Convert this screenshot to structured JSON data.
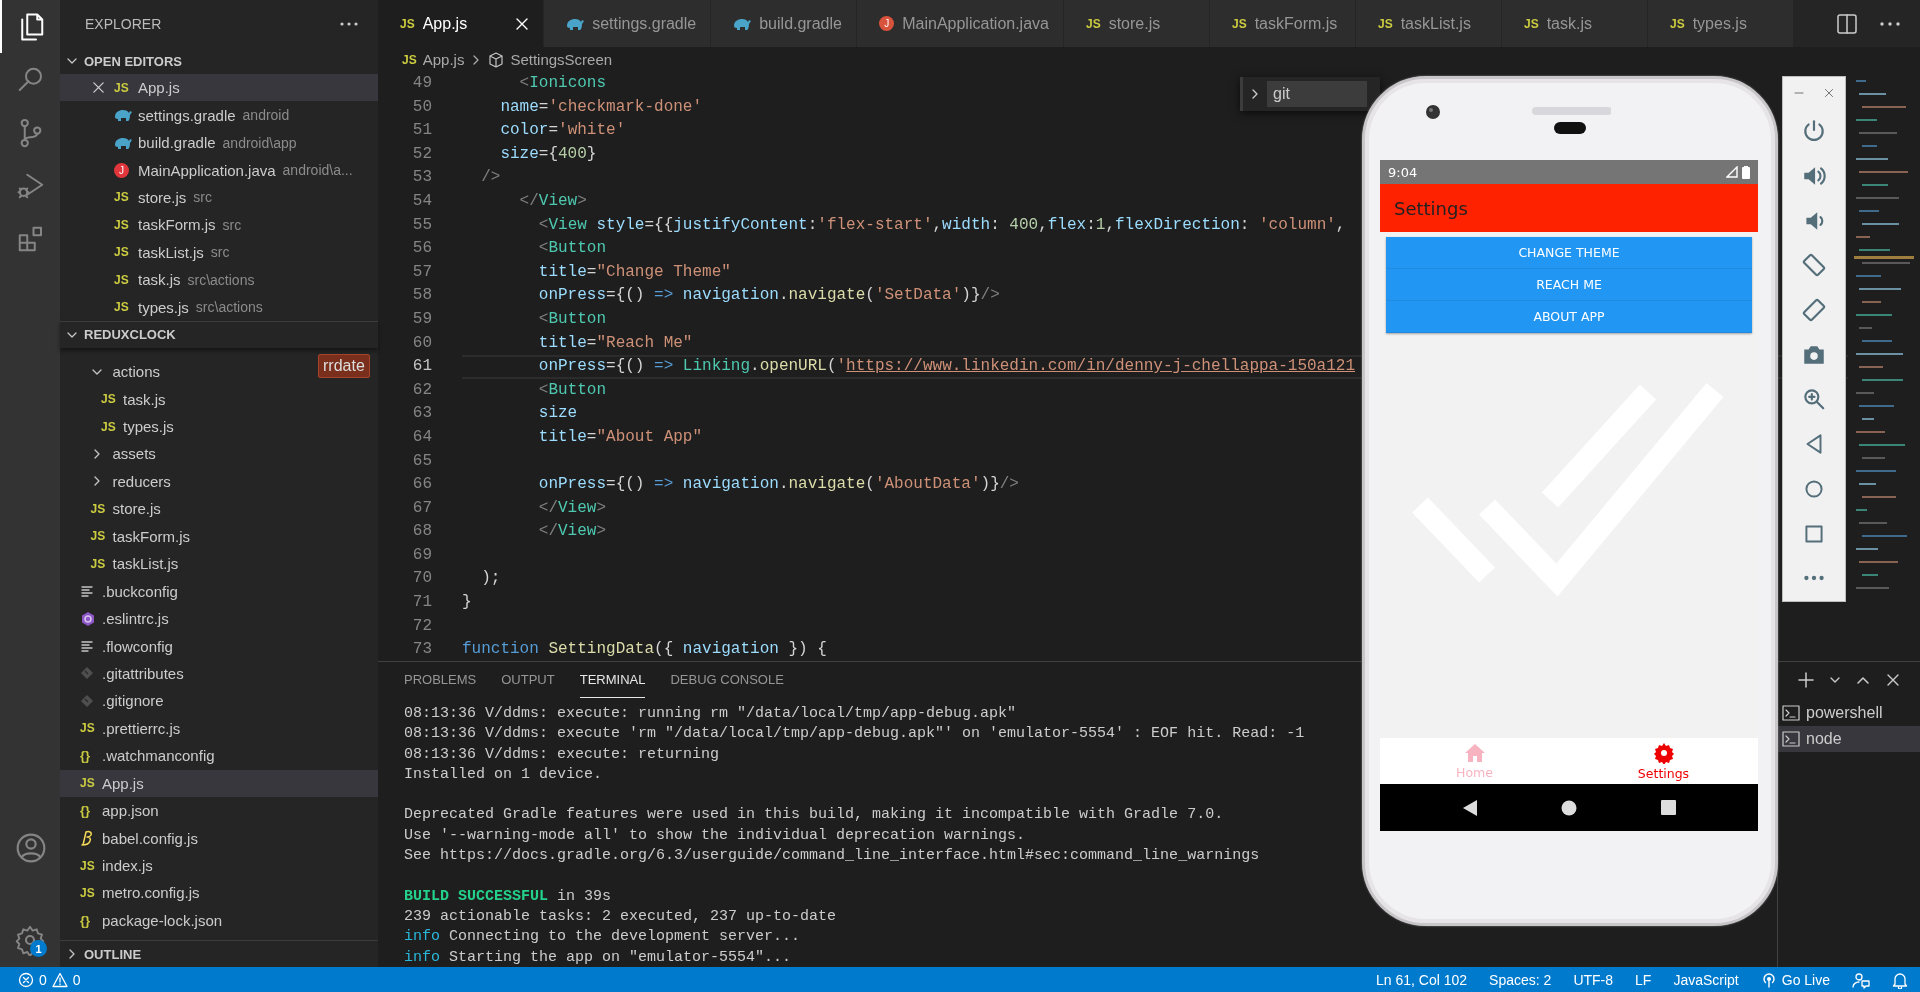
{
  "activity_bar": {
    "items": [
      {
        "kind": "explorer",
        "selected": true
      },
      {
        "kind": "search",
        "selected": false
      },
      {
        "kind": "source_control",
        "selected": false
      },
      {
        "kind": "debug",
        "selected": false
      },
      {
        "kind": "extensions",
        "selected": false
      }
    ],
    "settings_badge": "1"
  },
  "explorer": {
    "title": "EXPLORER",
    "hover_label": "rrdate",
    "open_editors": {
      "title": "OPEN EDITORS",
      "expanded": true,
      "items": [
        {
          "kind": "js",
          "icon": "JS",
          "name": "App.js",
          "selected": true
        },
        {
          "kind": "gradle",
          "name": "settings.gradle",
          "description": "android",
          "selected": false
        },
        {
          "kind": "gradle",
          "name": "build.gradle",
          "description": "android\\app",
          "selected": false
        },
        {
          "kind": "java",
          "icon": "J",
          "name": "MainApplication.java",
          "description": "android\\a...",
          "selected": false
        },
        {
          "kind": "js",
          "icon": "JS",
          "name": "store.js",
          "description": "src",
          "selected": false
        },
        {
          "kind": "js",
          "icon": "JS",
          "name": "taskForm.js",
          "description": "src",
          "selected": false
        },
        {
          "kind": "js",
          "icon": "JS",
          "name": "taskList.js",
          "description": "src",
          "selected": false
        },
        {
          "kind": "js",
          "icon": "JS",
          "name": "task.js",
          "description": "src\\actions",
          "selected": false
        },
        {
          "kind": "js",
          "icon": "JS",
          "name": "types.js",
          "description": "src\\actions",
          "selected": false
        }
      ]
    },
    "project": {
      "title": "REDUXCLOCK",
      "expanded": true,
      "tree": [
        {
          "children": [
            {
              "kind": "folder",
              "name": "actions",
              "expanded": true,
              "selected": false,
              "children": [
                {
                  "kind": "js",
                  "icon": "JS",
                  "name": "task.js",
                  "selected": false
                },
                {
                  "kind": "js",
                  "icon": "JS",
                  "name": "types.js",
                  "selected": false
                }
              ]
            },
            {
              "kind": "folder",
              "name": "assets",
              "expanded": false,
              "selected": false
            },
            {
              "kind": "folder",
              "name": "reducers",
              "expanded": false,
              "selected": false
            },
            {
              "kind": "js",
              "icon": "JS",
              "name": "store.js",
              "selected": false
            },
            {
              "kind": "js",
              "icon": "JS",
              "name": "taskForm.js",
              "selected": false
            },
            {
              "kind": "js",
              "icon": "JS",
              "name": "taskList.js",
              "selected": false
            }
          ]
        },
        {
          "kind": "config",
          "name": ".buckconfig",
          "selected": false
        },
        {
          "kind": "eslint",
          "name": ".eslintrc.js",
          "selected": false
        },
        {
          "kind": "config",
          "name": ".flowconfig",
          "selected": false
        },
        {
          "kind": "git",
          "name": ".gitattributes",
          "selected": false
        },
        {
          "kind": "git",
          "name": ".gitignore",
          "selected": false
        },
        {
          "kind": "js",
          "icon": "JS",
          "name": ".prettierrc.js",
          "selected": false
        },
        {
          "kind": "json",
          "icon": "{}",
          "name": ".watchmanconfig",
          "selected": false
        },
        {
          "kind": "js",
          "icon": "JS",
          "name": "App.js",
          "selected": true
        },
        {
          "kind": "json",
          "icon": "{}",
          "name": "app.json",
          "selected": false
        },
        {
          "kind": "babel",
          "name": "babel.config.js",
          "selected": false
        },
        {
          "kind": "js",
          "icon": "JS",
          "name": "index.js",
          "selected": false
        },
        {
          "kind": "js",
          "icon": "JS",
          "name": "metro.config.js",
          "selected": false
        },
        {
          "kind": "json",
          "icon": "{}",
          "name": "package-lock.json",
          "selected": false
        }
      ]
    },
    "outline": {
      "title": "OUTLINE",
      "expanded": false
    }
  },
  "editor": {
    "tabs": [
      {
        "kind": "js",
        "icon": "JS",
        "label": "App.js",
        "selected": true
      },
      {
        "kind": "gradle",
        "label": "settings.gradle",
        "selected": false
      },
      {
        "kind": "gradle",
        "label": "build.gradle",
        "selected": false
      },
      {
        "kind": "java",
        "icon": "J",
        "label": "MainApplication.java",
        "selected": false
      },
      {
        "kind": "js",
        "icon": "JS",
        "label": "store.js",
        "selected": false
      },
      {
        "kind": "js",
        "icon": "JS",
        "label": "taskForm.js",
        "selected": false
      },
      {
        "kind": "js",
        "icon": "JS",
        "label": "taskList.js",
        "selected": false
      },
      {
        "kind": "js",
        "icon": "JS",
        "label": "task.js",
        "selected": false
      },
      {
        "kind": "js",
        "icon": "JS",
        "label": "types.js",
        "selected": false
      }
    ],
    "breadcrumb": {
      "icon": "JS",
      "file": "App.js",
      "symbol": "SettingsScreen"
    },
    "find_widget": {
      "value": "git"
    },
    "lines": [
      {
        "number": "49",
        "current": false,
        "tokens": [
          {
            "kind": "bracket",
            "text": "      <"
          },
          {
            "kind": "tag",
            "text": "Ionicons"
          }
        ]
      },
      {
        "number": "50",
        "current": false,
        "tokens": [
          {
            "kind": "attr",
            "text": "    name"
          },
          {
            "kind": "punct",
            "text": "="
          },
          {
            "kind": "string",
            "text": "'checkmark-done'"
          }
        ]
      },
      {
        "number": "51",
        "current": false,
        "tokens": [
          {
            "kind": "attr",
            "text": "    color"
          },
          {
            "kind": "punct",
            "text": "="
          },
          {
            "kind": "string",
            "text": "'white'"
          }
        ]
      },
      {
        "number": "52",
        "current": false,
        "tokens": [
          {
            "kind": "attr",
            "text": "    size"
          },
          {
            "kind": "punct",
            "text": "={"
          },
          {
            "kind": "number",
            "text": "400"
          },
          {
            "kind": "punct",
            "text": "}"
          }
        ]
      },
      {
        "number": "53",
        "current": false,
        "tokens": [
          {
            "kind": "bracket",
            "text": "  />"
          }
        ]
      },
      {
        "number": "54",
        "current": false,
        "tokens": [
          {
            "kind": "bracket",
            "text": "      </"
          },
          {
            "kind": "tag",
            "text": "View"
          },
          {
            "kind": "bracket",
            "text": ">"
          }
        ]
      },
      {
        "number": "55",
        "current": false,
        "tokens": [
          {
            "kind": "bracket",
            "text": "        <"
          },
          {
            "kind": "tag",
            "text": "View"
          },
          {
            "kind": "attr",
            "text": " style"
          },
          {
            "kind": "punct",
            "text": "={{"
          },
          {
            "kind": "attr",
            "text": "justifyContent"
          },
          {
            "kind": "punct",
            "text": ":"
          },
          {
            "kind": "string",
            "text": "'flex-start'"
          },
          {
            "kind": "punct",
            "text": ","
          },
          {
            "kind": "attr",
            "text": "width"
          },
          {
            "kind": "punct",
            "text": ": "
          },
          {
            "kind": "number",
            "text": "400"
          },
          {
            "kind": "punct",
            "text": ","
          },
          {
            "kind": "attr",
            "text": "flex"
          },
          {
            "kind": "punct",
            "text": ":"
          },
          {
            "kind": "number",
            "text": "1"
          },
          {
            "kind": "punct",
            "text": ","
          },
          {
            "kind": "attr",
            "text": "flexDirection"
          },
          {
            "kind": "punct",
            "text": ": "
          },
          {
            "kind": "string",
            "text": "'column'"
          },
          {
            "kind": "punct",
            "text": ","
          }
        ]
      },
      {
        "number": "56",
        "current": false,
        "tokens": [
          {
            "kind": "bracket",
            "text": "        <"
          },
          {
            "kind": "tag",
            "text": "Button"
          }
        ]
      },
      {
        "number": "57",
        "current": false,
        "tokens": [
          {
            "kind": "attr",
            "text": "        title"
          },
          {
            "kind": "punct",
            "text": "="
          },
          {
            "kind": "string",
            "text": "\"Change Theme\""
          }
        ]
      },
      {
        "number": "58",
        "current": false,
        "tokens": [
          {
            "kind": "attr",
            "text": "        onPress"
          },
          {
            "kind": "punct",
            "text": "={() "
          },
          {
            "kind": "keyword",
            "text": "=>"
          },
          {
            "kind": "variable",
            "text": " navigation"
          },
          {
            "kind": "punct",
            "text": "."
          },
          {
            "kind": "function",
            "text": "navigate"
          },
          {
            "kind": "punct",
            "text": "("
          },
          {
            "kind": "string",
            "text": "'SetData'"
          },
          {
            "kind": "punct",
            "text": ")}"
          },
          {
            "kind": "bracket",
            "text": "/>"
          }
        ]
      },
      {
        "number": "59",
        "current": false,
        "tokens": [
          {
            "kind": "bracket",
            "text": "        <"
          },
          {
            "kind": "tag",
            "text": "Button"
          }
        ]
      },
      {
        "number": "60",
        "current": false,
        "tokens": [
          {
            "kind": "attr",
            "text": "        title"
          },
          {
            "kind": "punct",
            "text": "="
          },
          {
            "kind": "string",
            "text": "\"Reach Me\""
          }
        ]
      },
      {
        "number": "61",
        "current": true,
        "tokens": [
          {
            "kind": "attr",
            "text": "        onPress"
          },
          {
            "kind": "punct",
            "text": "={() "
          },
          {
            "kind": "keyword",
            "text": "=>"
          },
          {
            "kind": "class",
            "text": " Linking"
          },
          {
            "kind": "punct",
            "text": "."
          },
          {
            "kind": "function",
            "text": "openURL"
          },
          {
            "kind": "punct",
            "text": "("
          },
          {
            "kind": "string",
            "text": "'"
          },
          {
            "kind": "link",
            "text": "https://www.linkedin.com/in/denny-j-chellappa-150a121"
          }
        ]
      },
      {
        "number": "62",
        "current": false,
        "tokens": [
          {
            "kind": "bracket",
            "text": "        <"
          },
          {
            "kind": "tag",
            "text": "Button"
          }
        ]
      },
      {
        "number": "63",
        "current": false,
        "tokens": [
          {
            "kind": "attr",
            "text": "        size"
          }
        ]
      },
      {
        "number": "64",
        "current": false,
        "tokens": [
          {
            "kind": "attr",
            "text": "        title"
          },
          {
            "kind": "punct",
            "text": "="
          },
          {
            "kind": "string",
            "text": "\"About App\""
          }
        ]
      },
      {
        "number": "65",
        "current": false
      },
      {
        "number": "66",
        "current": false,
        "tokens": [
          {
            "kind": "attr",
            "text": "        onPress"
          },
          {
            "kind": "punct",
            "text": "={() "
          },
          {
            "kind": "keyword",
            "text": "=>"
          },
          {
            "kind": "variable",
            "text": " navigation"
          },
          {
            "kind": "punct",
            "text": "."
          },
          {
            "kind": "function",
            "text": "navigate"
          },
          {
            "kind": "punct",
            "text": "("
          },
          {
            "kind": "string",
            "text": "'AboutData'"
          },
          {
            "kind": "punct",
            "text": ")}"
          },
          {
            "kind": "bracket",
            "text": "/>"
          }
        ]
      },
      {
        "number": "67",
        "current": false,
        "tokens": [
          {
            "kind": "bracket",
            "text": "        </"
          },
          {
            "kind": "tag",
            "text": "View"
          },
          {
            "kind": "bracket",
            "text": ">"
          }
        ]
      },
      {
        "number": "68",
        "current": false,
        "tokens": [
          {
            "kind": "bracket",
            "text": "        </"
          },
          {
            "kind": "tag",
            "text": "View"
          },
          {
            "kind": "bracket",
            "text": ">"
          }
        ]
      },
      {
        "number": "69",
        "current": false
      },
      {
        "number": "70",
        "current": false,
        "tokens": [
          {
            "kind": "punct",
            "text": "  );"
          }
        ]
      },
      {
        "number": "71",
        "current": false,
        "tokens": [
          {
            "kind": "punct",
            "text": "}"
          }
        ]
      },
      {
        "number": "72",
        "current": false
      },
      {
        "number": "73",
        "current": false,
        "tokens": [
          {
            "kind": "keyword",
            "text": "function"
          },
          {
            "kind": "function",
            "text": " SettingData"
          },
          {
            "kind": "punct",
            "text": "({ "
          },
          {
            "kind": "variable",
            "text": "navigation"
          },
          {
            "kind": "punct",
            "text": " }) {"
          }
        ]
      }
    ]
  },
  "panel": {
    "tabs": [
      {
        "label": "PROBLEMS",
        "selected": false
      },
      {
        "label": "OUTPUT",
        "selected": false
      },
      {
        "label": "TERMINAL",
        "selected": true
      },
      {
        "label": "DEBUG CONSOLE",
        "selected": false
      }
    ],
    "terminal_lines": [
      {
        "kind": "text",
        "tokens": [
          {
            "kind": "plain",
            "text": "08:13:36 V/ddms: execute: running rm \"/data/local/tmp/app-debug.apk\""
          }
        ]
      },
      {
        "kind": "text",
        "tokens": [
          {
            "kind": "plain",
            "text": "08:13:36 V/ddms: execute 'rm \"/data/local/tmp/app-debug.apk\"' on 'emulator-5554' : EOF hit. Read: -1"
          }
        ]
      },
      {
        "kind": "text",
        "tokens": [
          {
            "kind": "plain",
            "text": "08:13:36 V/ddms: execute: returning"
          }
        ]
      },
      {
        "kind": "text",
        "tokens": [
          {
            "kind": "plain",
            "text": "Installed on 1 device."
          }
        ]
      },
      {
        "kind": "blank"
      },
      {
        "kind": "text",
        "tokens": [
          {
            "kind": "plain",
            "text": "Deprecated Gradle features were used in this build, making it incompatible with Gradle 7.0."
          }
        ]
      },
      {
        "kind": "text",
        "tokens": [
          {
            "kind": "plain",
            "text": "Use '--warning-mode all' to show the individual deprecation warnings."
          }
        ]
      },
      {
        "kind": "text",
        "tokens": [
          {
            "kind": "plain",
            "text": "See https://docs.gradle.org/6.3/userguide/command_line_interface.html#sec:command_line_warnings"
          }
        ]
      },
      {
        "kind": "blank"
      },
      {
        "kind": "text",
        "tokens": [
          {
            "kind": "success",
            "text": "BUILD SUCCESSFUL"
          },
          {
            "kind": "plain",
            "text": " in 39s"
          }
        ]
      },
      {
        "kind": "text",
        "tokens": [
          {
            "kind": "plain",
            "text": "239 actionable tasks: 2 executed, 237 up-to-date"
          }
        ]
      },
      {
        "kind": "text",
        "tokens": [
          {
            "kind": "info",
            "text": "info"
          },
          {
            "kind": "plain",
            "text": " Connecting to the development server..."
          }
        ]
      },
      {
        "kind": "text",
        "tokens": [
          {
            "kind": "info",
            "text": "info"
          },
          {
            "kind": "plain",
            "text": " Starting the app on \"emulator-5554\"..."
          }
        ]
      }
    ],
    "terminals": [
      {
        "label": "powershell",
        "selected": false
      },
      {
        "label": "node",
        "selected": true
      }
    ]
  },
  "phone": {
    "time": "9:04",
    "app_title": "Settings",
    "buttons": [
      "CHANGE THEME",
      "REACH ME",
      "ABOUT APP"
    ],
    "tabs": [
      {
        "kind": "home",
        "label": "Home",
        "selected": false
      },
      {
        "kind": "settings",
        "label": "Settings",
        "selected": true
      }
    ]
  },
  "status_bar": {
    "errors": "0",
    "warnings": "0",
    "items": [
      {
        "kind": "text",
        "text": "Ln 61, Col 102"
      },
      {
        "kind": "text",
        "text": "Spaces: 2"
      },
      {
        "kind": "text",
        "text": "UTF-8"
      },
      {
        "kind": "text",
        "text": "LF"
      },
      {
        "kind": "text",
        "text": "JavaScript"
      },
      {
        "kind": "live",
        "text": "Go Live"
      },
      {
        "kind": "feedback"
      },
      {
        "kind": "bell"
      }
    ]
  }
}
